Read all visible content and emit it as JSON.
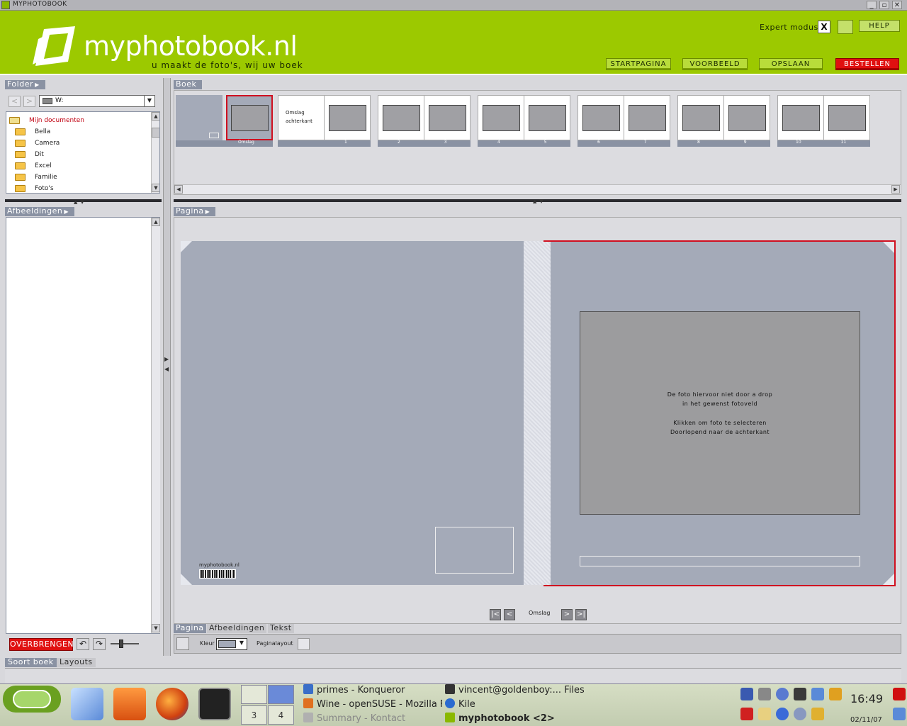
{
  "window": {
    "title": "MYPHOTOBOOK",
    "minimize": "_",
    "maximize": "▫",
    "close": "✕"
  },
  "header": {
    "logo_text": "myphotobook.nl",
    "tagline": "u maakt de foto's, wij uw boek",
    "expert_label": "Expert modus",
    "expert_value": "X",
    "help_label": "HELP",
    "nav": [
      "STARTPAGINA",
      "VOORBEELD",
      "OPSLAAN",
      "BESTELLEN"
    ],
    "accent_color": "#9cc900",
    "order_color": "#e01010"
  },
  "folder_panel": {
    "tab_label": "Folder",
    "back": "<",
    "forward": ">",
    "drive_value": "W:",
    "tree": [
      {
        "label": "Mijn documenten",
        "root": true
      },
      {
        "label": "Bella"
      },
      {
        "label": "Camera"
      },
      {
        "label": "Dit"
      },
      {
        "label": "Excel"
      },
      {
        "label": "Familie"
      },
      {
        "label": "Foto's"
      }
    ]
  },
  "images_panel": {
    "tab_label": "Afbeeldingen",
    "transfer_label": "OVERBRENGEN"
  },
  "book_panel": {
    "tab_label": "Boek",
    "pages": [
      {
        "label": "Omslag",
        "type": "cover"
      },
      {
        "label": "1",
        "type": "title"
      },
      {
        "label": "2 3"
      },
      {
        "label": "4 5"
      },
      {
        "label": "6 7"
      },
      {
        "label": "8 9"
      },
      {
        "label": "10 11"
      }
    ],
    "title_page_text": "Omslag achterkant"
  },
  "page_panel": {
    "tab_label": "Pagina",
    "back_brand": "myphotobook.nl",
    "photo_hint_line1": "De foto hiervoor niet door a drop",
    "photo_hint_line2": "in het gewenst fotoveld",
    "photo_hint_line3": "Klikken om foto te selecteren",
    "photo_hint_line4": "Doorlopend naar de achterkant",
    "nav_label": "Omslag",
    "nav_first": "|<",
    "nav_prev": "<",
    "nav_next": ">",
    "nav_last": ">|",
    "highlight_color": "#d01020"
  },
  "bottom_tabs": {
    "pagina": "Pagina",
    "afbeeldingen": "Afbeeldingen",
    "tekst": "Tekst",
    "bg_label": "Kleur",
    "layout_label": "Paginalayout"
  },
  "soort": {
    "tab_label": "Soort boek",
    "layouts_label": "Layouts"
  },
  "taskbar": {
    "pager": [
      "3",
      "4"
    ],
    "tasks": [
      {
        "label": "primes - Konqueror",
        "icon_color": "#3a6ec8"
      },
      {
        "label": "Wine - openSUSE - Mozilla Fi",
        "icon_color": "#e07020"
      },
      {
        "label": "Summary - Kontact",
        "icon_color": "#b0b0b0"
      },
      {
        "label": "vincent@goldenboy:... Files/m",
        "icon_color": "#333333"
      },
      {
        "label": "Kile",
        "icon_color": "#2a6ad0"
      },
      {
        "label": "myphotobook <2>",
        "icon_color": "#8ab800"
      }
    ],
    "clock": "16:49",
    "date": "02/11/07"
  }
}
